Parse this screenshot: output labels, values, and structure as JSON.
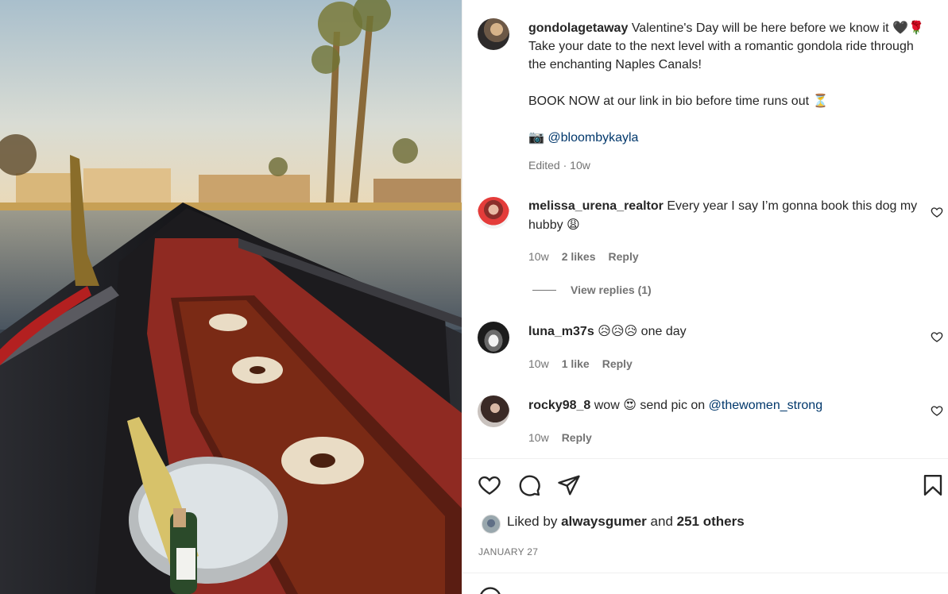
{
  "post": {
    "username": "gondolagetaway",
    "caption_line1": "Valentine's Day will be here before we know it",
    "caption_line1_emoji": "🖤🌹",
    "caption_line2": "Take your date to the next level with a romantic gondola ride through the enchanting Naples Canals!",
    "caption_para2": "BOOK NOW at our link in bio before time runs out",
    "caption_para2_emoji": "⏳",
    "camera_emoji": "📷",
    "credit_handle": "@bloombykayla",
    "edited_label": "Edited",
    "edited_time": "10w"
  },
  "comments": [
    {
      "username": "melissa_urena_realtor",
      "text": "Every year I say I’m gonna book this dog my hubby",
      "emoji": "😩",
      "time": "10w",
      "likes": "2 likes",
      "reply_label": "Reply",
      "view_replies": "View replies (1)"
    },
    {
      "username": "luna_m37s",
      "emoji": "😥😥😥",
      "text": "one day",
      "time": "10w",
      "likes": "1 like",
      "reply_label": "Reply"
    },
    {
      "username": "rocky98_8",
      "text_before": "wow",
      "emoji": "😍",
      "text_after": "send pic on",
      "mention": "@thewomen_strong",
      "time": "10w",
      "reply_label": "Reply"
    }
  ],
  "actions": {
    "icons": [
      "heart-icon",
      "comment-icon",
      "share-icon",
      "bookmark-icon"
    ],
    "liked_prefix": "Liked by",
    "liked_user": "alwaysgumer",
    "liked_and": "and",
    "liked_others": "251 others",
    "date": "JANUARY 27"
  },
  "colors": {
    "text": "#262626",
    "muted": "#737373",
    "link": "#00376b",
    "divider": "#efefef"
  }
}
